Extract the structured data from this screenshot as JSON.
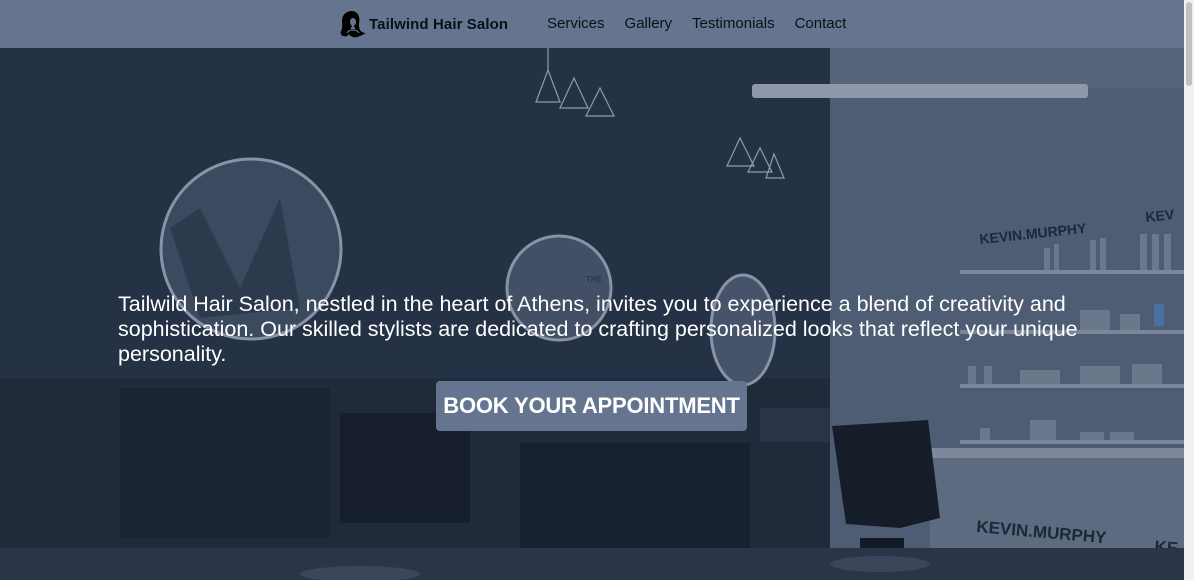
{
  "brand": {
    "name": "Tailwind Hair Salon",
    "logo_icon": "woman-silhouette-icon"
  },
  "nav": {
    "links": [
      "Services",
      "Gallery",
      "Testimonials",
      "Contact"
    ]
  },
  "hero": {
    "description": "Tailwild Hair Salon, nestled in the heart of Athens, invites you to experience a blend of creativity and sophistication. Our skilled stylists are dedicated to crafting personalized looks that reflect your unique personality.",
    "cta_label": "BOOK YOUR APPOINTMENT",
    "background": {
      "signage": [
        "KEVIN.MURPHY",
        "KEVIN.MURPHY",
        "KEV",
        "KE",
        "THE"
      ]
    }
  },
  "colors": {
    "navbar": "#65758f",
    "overlay": "#1f2b3d",
    "cta": "#66758f",
    "text_dark": "#0b0f18",
    "text_light": "#ffffff"
  }
}
